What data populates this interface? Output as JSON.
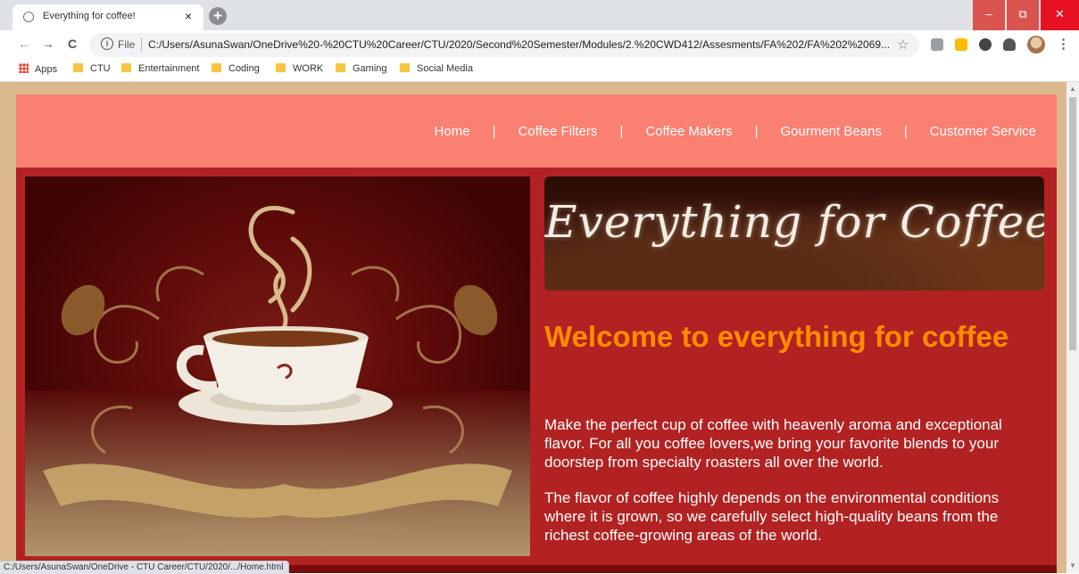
{
  "browser": {
    "tab_title": "Everything for coffee!",
    "tab_close": "×",
    "new_tab": "+",
    "window_buttons": {
      "minimize": "–",
      "maximize": "⧉",
      "close": "✕"
    },
    "nav": {
      "back": "←",
      "forward": "→",
      "reload": "C"
    },
    "address": {
      "info": "i",
      "scheme_label": "File",
      "url": "C:/Users/AsunaSwan/OneDrive%20-%20CTU%20Career/CTU/2020/Second%20Semester/Modules/2.%20CWD412/Assesments/FA%202/FA%202%2069...",
      "star": "☆"
    },
    "menu": "⋮",
    "bookmarks": [
      "Apps",
      "CTU",
      "Entertainment",
      "Coding",
      "WORK",
      "Gaming",
      "Social Media"
    ],
    "status_text": "C:/Users/AsunaSwan/OneDrive - CTU Career/CTU/2020/.../Home.html",
    "scroll_up": "▲",
    "scroll_down": "▼"
  },
  "site": {
    "nav_items": [
      "Home",
      "Coffee Filters",
      "Coffee Makers",
      "Gourment Beans",
      "Customer Service"
    ],
    "nav_separator": "|",
    "banner_text": "Everything for Coffee",
    "heading": "Welcome to everything for coffee",
    "paragraphs": [
      "Make the perfect cup of coffee with heavenly aroma and exceptional flavor. For all you coffee lovers,we bring your favorite blends to your doorstep from specialty roasters all over the world.",
      "The flavor of coffee highly depends on the environmental conditions where it is grown, so we carefully select high-quality beans from the richest coffee-growing areas of the world."
    ]
  },
  "colors": {
    "header": "#fa8072",
    "body": "#b22222",
    "heading": "#ff8c00",
    "frame": "#dbb98e"
  }
}
